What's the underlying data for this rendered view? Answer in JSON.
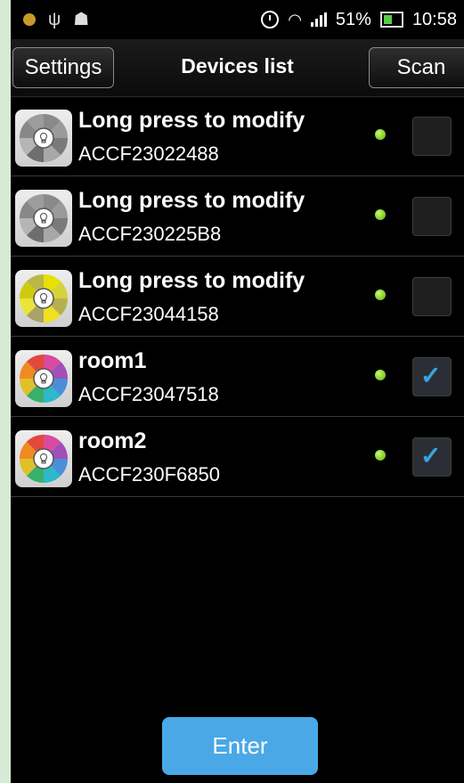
{
  "status_bar": {
    "battery_percent": "51%",
    "time": "10:58",
    "icons": [
      "notification-dot-icon",
      "usb-icon",
      "android-debug-icon",
      "alarm-icon",
      "wifi-icon",
      "signal-icon",
      "battery-icon"
    ]
  },
  "header": {
    "settings_label": "Settings",
    "title": "Devices list",
    "scan_label": "Scan"
  },
  "devices": [
    {
      "name": "Long press to modify",
      "mac": "ACCF23022488",
      "online": true,
      "checked": false,
      "icon": "gray"
    },
    {
      "name": "Long press to modify",
      "mac": "ACCF230225B8",
      "online": true,
      "checked": false,
      "icon": "gray"
    },
    {
      "name": "Long press to modify",
      "mac": "ACCF23044158",
      "online": true,
      "checked": false,
      "icon": "yellow"
    },
    {
      "name": "room1",
      "mac": "ACCF23047518",
      "online": true,
      "checked": true,
      "icon": "color"
    },
    {
      "name": "room2",
      "mac": "ACCF230F6850",
      "online": true,
      "checked": true,
      "icon": "color"
    }
  ],
  "footer": {
    "enter_label": "Enter"
  },
  "colors": {
    "accent": "#4aa8e6",
    "check": "#3aa4e2",
    "online_led": "#8fd22c"
  }
}
